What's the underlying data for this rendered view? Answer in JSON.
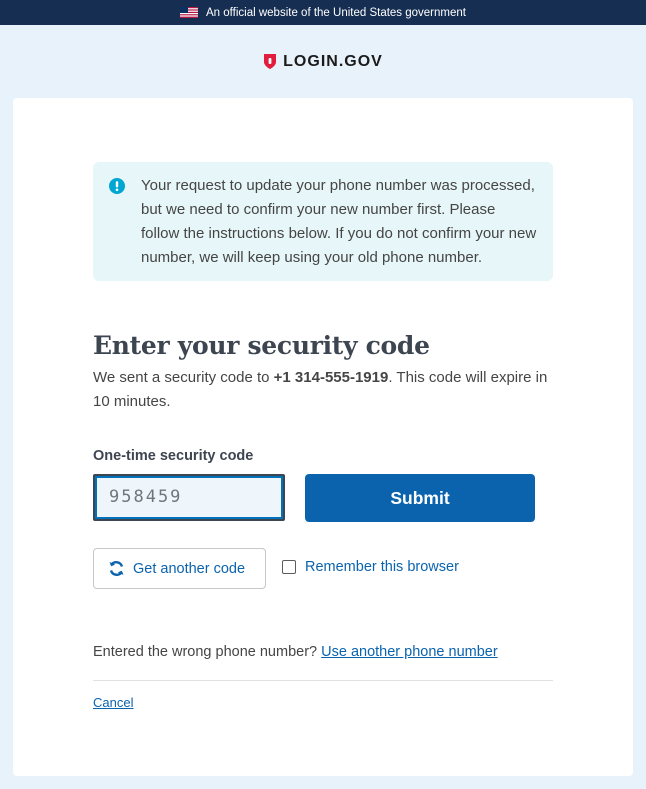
{
  "gov_banner": {
    "flag_icon": "us-flag-icon",
    "text": "An official website of the United States government"
  },
  "header": {
    "logo_icon": "shield-lock-icon",
    "logo_text": "LOGIN.GOV"
  },
  "alert": {
    "icon": "info-exclamation-icon",
    "message": "Your request to update your phone number was processed, but we need to confirm your new number first. Please follow the instructions below. If you do not confirm your new number, we will keep using your old phone number."
  },
  "main": {
    "heading": "Enter your security code",
    "desc_prefix": "We sent a security code to ",
    "phone": "+1 314-555-1919",
    "desc_suffix": ". This code will expire in 10 minutes.",
    "code_label": "One-time security code",
    "code_value": "958459",
    "submit_label": "Submit",
    "another_code_icon": "refresh-icon",
    "another_code_label": "Get another code",
    "remember_label": "Remember this browser",
    "remember_checked": false,
    "wrong_prefix": "Entered the wrong phone number?",
    "wrong_link": "Use another phone number",
    "cancel_label": "Cancel"
  },
  "colors": {
    "banner_bg": "#162e51",
    "page_bg": "#e8f2fa",
    "primary": "#0b63ae",
    "alert_bg": "#e7f6f8",
    "logo_red": "#e21c3d"
  }
}
